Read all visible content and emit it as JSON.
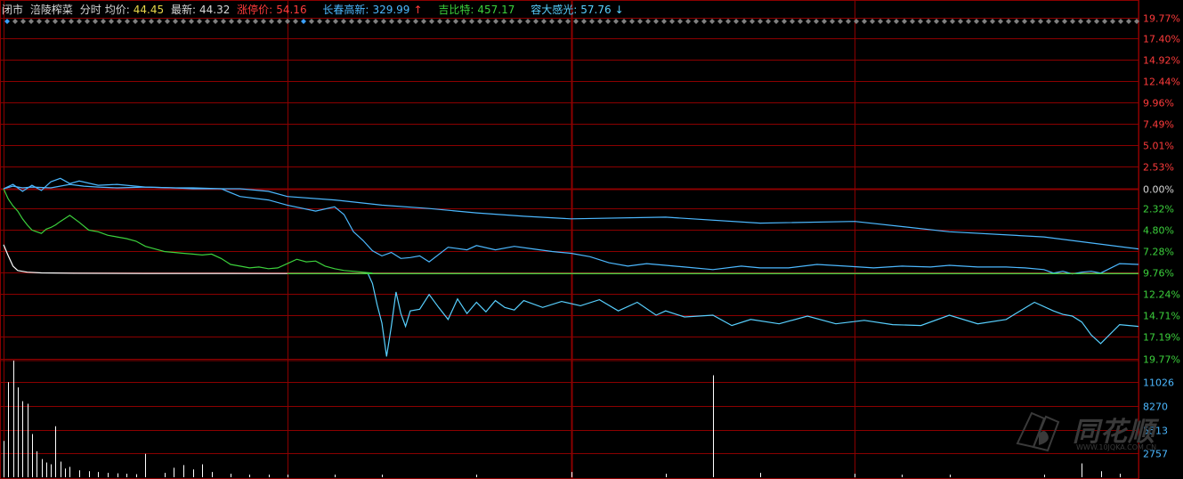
{
  "header": {
    "status": "闭市",
    "stock_name": "涪陵榨菜",
    "mode": "分时",
    "avg_label": "均价:",
    "avg_value": "44.45",
    "last_label": "最新:",
    "last_value": "44.32",
    "limit_label": "涨停价:",
    "limit_value": "54.16",
    "comp1_label": "长春高新:",
    "comp1_value": "329.99",
    "comp1_arrow": "↑",
    "comp2_label": "吉比特:",
    "comp2_value": "457.17",
    "comp3_label": "容大感光:",
    "comp3_value": "57.76",
    "comp3_arrow": "↓"
  },
  "colors": {
    "background": "#000000",
    "grid": "#8b0000",
    "stock_line": "#ffffff",
    "avg_line": "#e8d84a",
    "comp1_line": "#4cb8ff",
    "comp2_line": "#3cd13c",
    "comp3_line": "#58d0ff",
    "volume": "#ffffff",
    "up_label": "#ff3b3b",
    "down_label": "#3cd13c",
    "volume_label": "#4cb8ff"
  },
  "logo": {
    "text": "同花顺",
    "url": "WWW.10JQKA.COM.CN"
  },
  "chart_data": {
    "type": "line",
    "title": "",
    "xlabel": "",
    "ylabel": "",
    "x_range": [
      0,
      240
    ],
    "ylim": [
      -19.77,
      19.77
    ],
    "grid": true,
    "y_tick_labels_up": [
      "19.77%",
      "17.40%",
      "14.92%",
      "12.44%",
      "9.96%",
      "7.49%",
      "5.01%",
      "2.53%",
      "0.00%"
    ],
    "y_tick_labels_down": [
      "2.32%",
      "4.80%",
      "7.28%",
      "9.76%",
      "12.24%",
      "14.71%",
      "17.19%",
      "19.77%"
    ],
    "y_ticks_up_values": [
      19.77,
      17.4,
      14.92,
      12.44,
      9.96,
      7.49,
      5.01,
      2.53,
      0.0
    ],
    "y_ticks_down_values": [
      -2.32,
      -4.8,
      -7.28,
      -9.76,
      -12.24,
      -14.71,
      -17.19,
      -19.77
    ],
    "series": [
      {
        "x": [
          0,
          1,
          2,
          3,
          5,
          8,
          15,
          30,
          60,
          120,
          240
        ],
        "values": [
          -6.5,
          -7.8,
          -9.0,
          -9.5,
          -9.7,
          -9.78,
          -9.82,
          -9.84,
          -9.85,
          -9.86,
          -9.87
        ]
      },
      {
        "x": [
          0,
          2,
          4,
          6,
          10,
          14,
          17,
          20,
          24,
          30,
          36,
          40,
          46,
          50,
          56,
          60,
          70,
          80,
          90,
          100,
          110,
          120,
          140,
          160,
          180,
          200,
          220,
          240
        ],
        "values": [
          0,
          0.3,
          0.1,
          0.2,
          0.1,
          0.5,
          0.3,
          0.2,
          0.1,
          0.2,
          0.1,
          0.0,
          0.0,
          0.0,
          -0.3,
          -0.9,
          -1.3,
          -1.9,
          -2.3,
          -2.8,
          -3.2,
          -3.5,
          -3.3,
          -4.0,
          -3.8,
          -5.0,
          -5.6,
          -7.0
        ]
      },
      {
        "x": [
          0,
          1,
          2,
          3,
          4,
          5,
          6,
          7,
          8,
          9,
          10,
          11,
          12,
          14,
          16,
          18,
          20,
          22,
          24,
          26,
          28,
          30,
          32,
          34,
          36,
          38,
          40,
          42,
          44,
          46,
          48,
          50,
          52,
          54,
          56,
          58,
          60,
          62,
          64,
          66,
          68,
          70,
          72,
          74,
          76,
          77,
          78
        ],
        "values": [
          0.0,
          -1.2,
          -2.0,
          -2.6,
          -3.5,
          -4.2,
          -4.8,
          -5.0,
          -5.2,
          -4.7,
          -4.5,
          -4.2,
          -3.8,
          -3.1,
          -3.9,
          -4.8,
          -5.0,
          -5.4,
          -5.6,
          -5.8,
          -6.1,
          -6.7,
          -7.0,
          -7.3,
          -7.4,
          -7.5,
          -7.6,
          -7.7,
          -7.6,
          -8.1,
          -8.8,
          -9.0,
          -9.2,
          -9.1,
          -9.3,
          -9.2,
          -8.7,
          -8.2,
          -8.5,
          -8.4,
          -9.0,
          -9.3,
          -9.5,
          -9.6,
          -9.7,
          -9.75,
          -9.8
        ]
      },
      {
        "x": [
          0,
          2,
          4,
          6,
          8,
          10,
          12,
          14,
          16,
          20,
          24,
          30,
          36,
          40,
          46,
          50,
          56,
          60,
          66,
          70,
          72,
          74,
          76,
          78,
          80,
          82,
          84,
          86,
          88,
          90,
          94,
          98,
          100,
          104,
          108,
          112,
          116,
          120,
          124,
          128,
          132,
          136,
          140,
          144,
          150,
          156,
          160,
          166,
          172,
          178,
          184,
          190,
          196,
          200,
          206,
          212,
          216,
          220,
          222,
          224,
          226,
          228,
          230,
          232,
          236,
          240
        ],
        "values": [
          0.0,
          0.5,
          -0.3,
          0.4,
          -0.2,
          0.8,
          1.2,
          0.6,
          0.9,
          0.4,
          0.5,
          0.2,
          0.1,
          0.1,
          0.0,
          -0.9,
          -1.3,
          -1.9,
          -2.6,
          -2.1,
          -3.0,
          -5.0,
          -6.0,
          -7.2,
          -7.8,
          -7.4,
          -8.1,
          -8.0,
          -7.8,
          -8.5,
          -6.8,
          -7.1,
          -6.6,
          -7.1,
          -6.7,
          -7.0,
          -7.3,
          -7.5,
          -7.9,
          -8.6,
          -9.0,
          -8.7,
          -8.9,
          -9.1,
          -9.4,
          -9.0,
          -9.2,
          -9.2,
          -8.8,
          -9.0,
          -9.2,
          -9.0,
          -9.1,
          -8.9,
          -9.1,
          -9.1,
          -9.2,
          -9.4,
          -9.8,
          -9.6,
          -9.9,
          -9.7,
          -9.6,
          -9.8,
          -8.7,
          -8.8
        ]
      },
      {
        "x": [
          77,
          78,
          79,
          80,
          81,
          82,
          83,
          84,
          85,
          86,
          88,
          90,
          92,
          94,
          96,
          98,
          100,
          102,
          104,
          106,
          108,
          110,
          114,
          118,
          122,
          126,
          130,
          134,
          138,
          140,
          144,
          150,
          154,
          158,
          164,
          170,
          176,
          182,
          188,
          194,
          200,
          206,
          212,
          218,
          222,
          224,
          226,
          228,
          230,
          232,
          236,
          240
        ],
        "values": [
          -9.8,
          -11.0,
          -13.5,
          -15.6,
          -19.5,
          -16.0,
          -12.0,
          -14.5,
          -16.0,
          -14.2,
          -14.0,
          -12.3,
          -13.8,
          -15.2,
          -12.8,
          -14.5,
          -13.2,
          -14.3,
          -13.0,
          -13.8,
          -14.1,
          -13.0,
          -13.8,
          -13.1,
          -13.6,
          -12.9,
          -14.2,
          -13.2,
          -14.7,
          -14.2,
          -14.9,
          -14.7,
          -15.9,
          -15.2,
          -15.7,
          -14.8,
          -15.7,
          -15.3,
          -15.8,
          -15.9,
          -14.7,
          -15.7,
          -15.2,
          -13.2,
          -14.2,
          -14.6,
          -14.8,
          -15.5,
          -17.0,
          -18.0,
          -15.8,
          -16.0
        ]
      }
    ],
    "volume": {
      "ylim": [
        0,
        13500
      ],
      "tick_labels": [
        "11026",
        "8270",
        "5513",
        "2757"
      ],
      "ticks": [
        11026,
        8270,
        5513,
        2757
      ],
      "x": [
        0,
        1,
        2,
        3,
        4,
        5,
        6,
        7,
        8,
        9,
        10,
        11,
        12,
        13,
        14,
        16,
        18,
        20,
        22,
        24,
        26,
        28,
        30,
        34,
        36,
        38,
        40,
        42,
        44,
        48,
        52,
        56,
        60,
        70,
        80,
        100,
        120,
        140,
        150,
        160,
        180,
        190,
        200,
        220,
        228,
        232,
        236
      ],
      "values": [
        4200,
        11000,
        13500,
        10400,
        8800,
        8500,
        5000,
        3000,
        2100,
        1700,
        1500,
        5900,
        1800,
        1000,
        1200,
        800,
        700,
        600,
        500,
        450,
        400,
        350,
        2700,
        500,
        1100,
        1400,
        900,
        1500,
        600,
        400,
        300,
        300,
        300,
        300,
        300,
        300,
        600,
        400,
        11800,
        500,
        400,
        300,
        300,
        300,
        1600,
        700,
        400
      ]
    }
  }
}
